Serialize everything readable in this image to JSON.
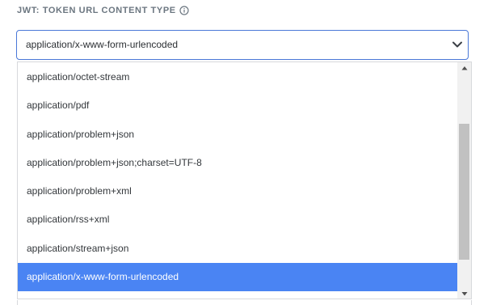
{
  "field": {
    "label": "JWT: TOKEN URL CONTENT TYPE",
    "info_icon": "info-circle-icon"
  },
  "select": {
    "value": "application/x-www-form-urlencoded",
    "chevron_icon": "chevron-down-icon",
    "accent_color": "#4a78d8"
  },
  "dropdown": {
    "options": [
      {
        "label": "application/octet-stream",
        "selected": false
      },
      {
        "label": "application/pdf",
        "selected": false
      },
      {
        "label": "application/problem+json",
        "selected": false
      },
      {
        "label": "application/problem+json;charset=UTF-8",
        "selected": false
      },
      {
        "label": "application/problem+xml",
        "selected": false
      },
      {
        "label": "application/rss+xml",
        "selected": false
      },
      {
        "label": "application/stream+json",
        "selected": false
      },
      {
        "label": "application/x-www-form-urlencoded",
        "selected": true
      }
    ],
    "selected_color": "#4a84f3",
    "scrollbar": {
      "up_icon": "arrow-up-icon",
      "down_icon": "arrow-down-icon"
    }
  }
}
